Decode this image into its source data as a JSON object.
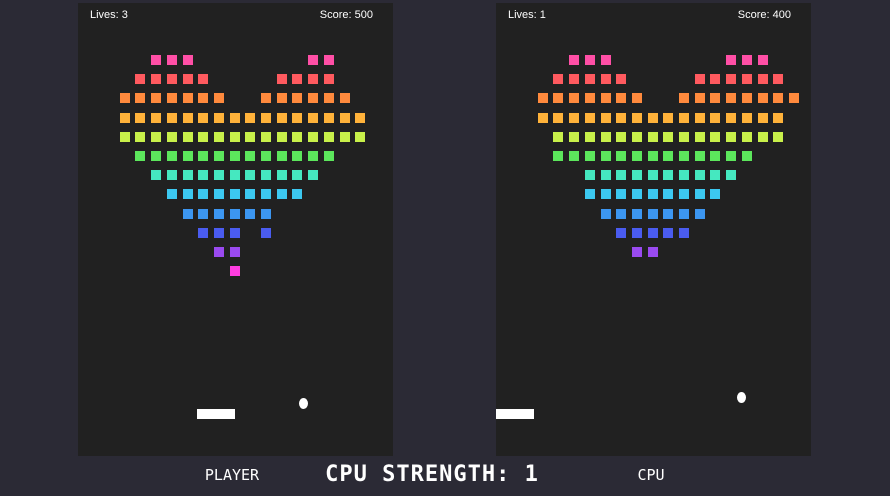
{
  "player": {
    "lives_text": "Lives: 3",
    "score_text": "Score: 500",
    "label": "PLAYER",
    "bricks": [
      "...XXX.......XX....",
      "..XXXXX....XXXX....",
      ".XXXXXXX..XXXXXX...",
      ".XXXXXXXXXXXXXXXX..",
      ".XXXXXXXXXXXXXXXX..",
      "..XXXXXXXXXXXXX....",
      "...XXXXXXXXXXX.....",
      "....XXXXXXXXX......",
      ".....XXXXXX........",
      "......XXX.X........",
      ".......XX..........",
      "........X.........."
    ]
  },
  "cpu": {
    "lives_text": "Lives: 1",
    "score_text": "Score: 400",
    "label": "CPU",
    "bricks": [
      "...XXX.......XXX...",
      "..XXXXX....XXXXXX..",
      ".XXXXXXX..XXXXXXXX.",
      ".XXXXXXXXXXXXXXXX..",
      "..XXXXXXXXXXXXXXX..",
      "..XXXXXXXXXXXXX....",
      "....XXXXXXXXXX.....",
      "....XXXXXXXXX......",
      ".....XXXXXXX.......",
      "......XXXXX........",
      ".......XX.........."
    ]
  },
  "row_colors": [
    "#ff4fa6",
    "#ff5a5f",
    "#ff8a3d",
    "#ffb23a",
    "#c8f04a",
    "#5ce65c",
    "#45e8c0",
    "#3cc8f0",
    "#3c96f0",
    "#4a5cf0",
    "#9a4af0",
    "#ff3de0"
  ],
  "center_text": "CPU STRENGTH: 1",
  "colors": {
    "background": "#2b2a35",
    "board": "#212121",
    "paddle": "#ffffff",
    "ball": "#ffffff"
  }
}
